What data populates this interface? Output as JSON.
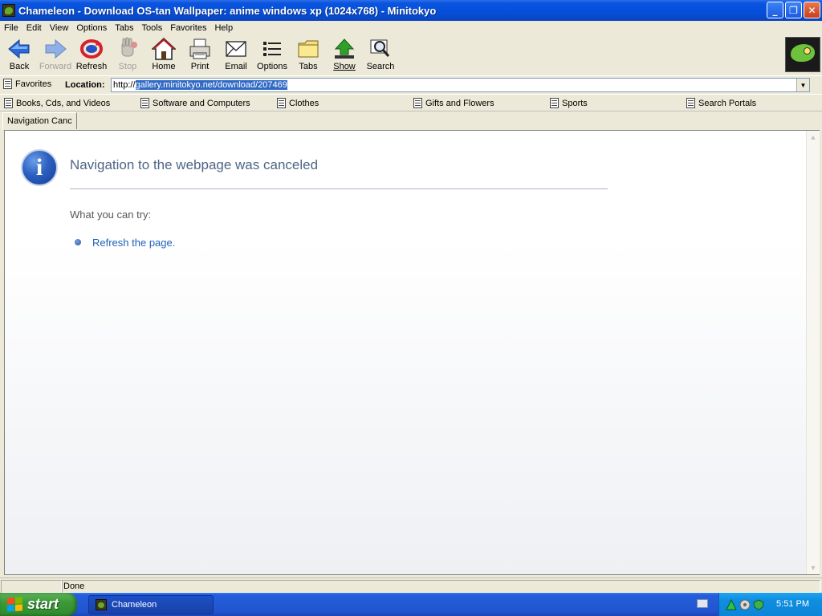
{
  "window": {
    "title": "Chameleon - Download OS-tan Wallpaper: anime windows xp (1024x768) - Minitokyo",
    "minimize": "_",
    "restore": "❐",
    "close": "✕"
  },
  "menu": [
    "File",
    "Edit",
    "View",
    "Options",
    "Tabs",
    "Tools",
    "Favorites",
    "Help"
  ],
  "toolbar": {
    "back": "Back",
    "forward": "Forward",
    "refresh": "Refresh",
    "stop": "Stop",
    "home": "Home",
    "print": "Print",
    "email": "Email",
    "options": "Options",
    "tabs": "Tabs",
    "show": "Show",
    "search": "Search"
  },
  "location": {
    "favorites": "Favorites",
    "label": "Location:",
    "url_prefix": "http://",
    "url_selected": "gallery.minitokyo.net/download/207469"
  },
  "links": [
    "Books, Cds, and Videos",
    "Software and Computers",
    "Clothes",
    "Gifts and Flowers",
    "Sports",
    "Search Portals"
  ],
  "tab": {
    "label": "Navigation Canc"
  },
  "page": {
    "title": "Navigation to the webpage was canceled",
    "try_label": "What you can try:",
    "refresh_link": "Refresh the page."
  },
  "status": {
    "text": "Done"
  },
  "taskbar": {
    "start": "start",
    "task": "Chameleon",
    "clock": "5:51 PM"
  }
}
